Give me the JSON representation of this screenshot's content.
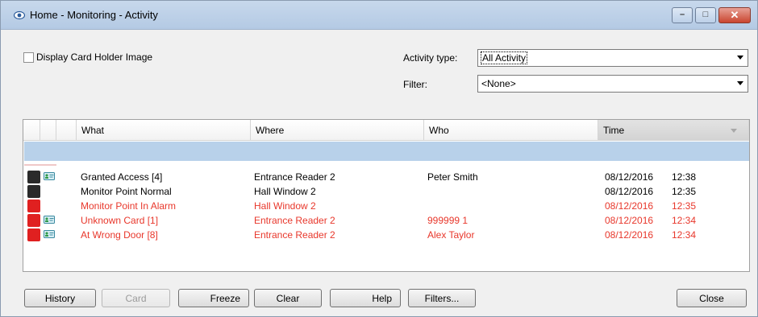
{
  "window": {
    "title": "Home - Monitoring - Activity"
  },
  "options": {
    "display_card_holder_image": "Display Card Holder Image",
    "activity_type_label": "Activity type:",
    "activity_type_value": "All Activity",
    "filter_label": "Filter:",
    "filter_value": "<None>"
  },
  "grid": {
    "columns": [
      "What",
      "Where",
      "Who",
      "Time"
    ],
    "sorted_column": "Time",
    "rows": [
      {
        "status": "dark",
        "card_icon": true,
        "what": "Granted Access [4]",
        "where": "Entrance Reader 2",
        "who": "Peter Smith",
        "date": "08/12/2016",
        "time": "12:38",
        "text_color": "black"
      },
      {
        "status": "dark",
        "card_icon": false,
        "what": "Monitor Point Normal",
        "where": "Hall Window 2",
        "who": "",
        "date": "08/12/2016",
        "time": "12:35",
        "text_color": "black"
      },
      {
        "status": "red",
        "card_icon": false,
        "what": "Monitor Point In Alarm",
        "where": "Hall Window 2",
        "who": "",
        "date": "08/12/2016",
        "time": "12:35",
        "text_color": "red"
      },
      {
        "status": "red",
        "card_icon": true,
        "what": "Unknown Card [1]",
        "where": "Entrance Reader 2",
        "who": "999999 1",
        "date": "08/12/2016",
        "time": "12:34",
        "text_color": "red"
      },
      {
        "status": "red",
        "card_icon": true,
        "what": "At Wrong Door [8]",
        "where": "Entrance Reader 2",
        "who": "Alex Taylor",
        "date": "08/12/2016",
        "time": "12:34",
        "text_color": "red"
      }
    ]
  },
  "buttons": {
    "history": "History",
    "card": "Card",
    "freeze": "Freeze",
    "clear": "Clear",
    "help": "Help",
    "filters": "Filters...",
    "close": "Close"
  },
  "colors": {
    "selection": "#b8d1ea",
    "alarm_red": "#e8372b",
    "status_dark": "#2a2a2a",
    "status_red": "#e02020"
  }
}
